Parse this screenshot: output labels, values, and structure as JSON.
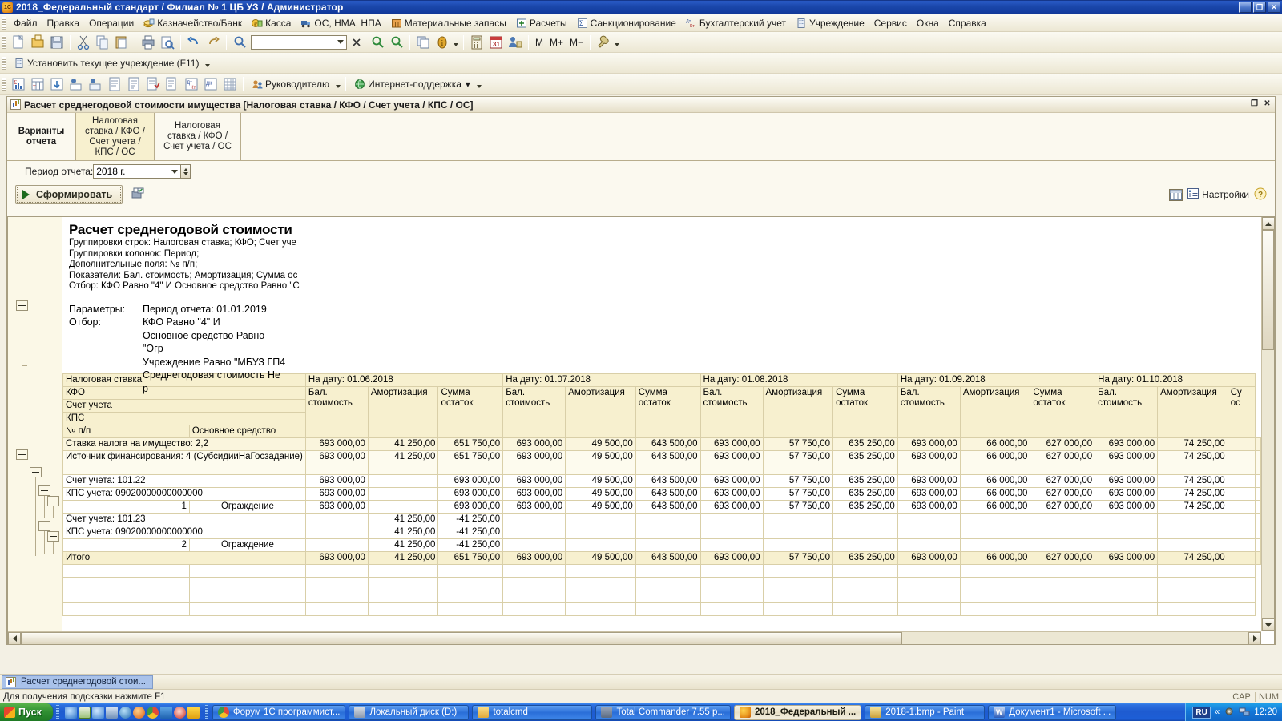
{
  "window": {
    "title": "2018_Федеральный стандарт / Филиал № 1 ЦБ УЗ / Администратор",
    "minimize": "_",
    "maximize": "❐",
    "close": "✕"
  },
  "menu": [
    {
      "label": "Файл",
      "icon": ""
    },
    {
      "label": "Правка",
      "icon": ""
    },
    {
      "label": "Операции",
      "icon": ""
    },
    {
      "label": "Казначейство/Банк",
      "icon": "money-icon"
    },
    {
      "label": "Касса",
      "icon": "cash-icon"
    },
    {
      "label": "ОС, НМА, НПА",
      "icon": "truck-icon"
    },
    {
      "label": "Материальные запасы",
      "icon": "warehouse-icon"
    },
    {
      "label": "Расчеты",
      "icon": "calc-icon"
    },
    {
      "label": "Санкционирование",
      "icon": "sigma-icon"
    },
    {
      "label": "Бухгалтерский учет",
      "icon": "dt-kt-icon"
    },
    {
      "label": "Учреждение",
      "icon": "building-icon"
    },
    {
      "label": "Сервис",
      "icon": ""
    },
    {
      "label": "Окна",
      "icon": ""
    },
    {
      "label": "Справка",
      "icon": ""
    }
  ],
  "toolbar_main": {
    "buttons": [
      "new-document-icon",
      "open-folder-icon",
      "save-icon",
      "cut-icon",
      "copy-icon",
      "paste-icon",
      "print-icon",
      "print-preview-icon",
      "undo-icon",
      "redo-icon",
      "find-icon"
    ],
    "search_value": "",
    "clear_label": "✕",
    "buttons2": [
      "refresh-find-icon",
      "find-next-icon",
      "copy-window-icon",
      "info-icon"
    ],
    "buttons3": [
      "calculator-icon",
      "calendar-icon",
      "user-settings-icon"
    ],
    "m_label": "M",
    "mplus_label": "M+",
    "mminus_label": "M−",
    "tools_icon": "wrench-icon"
  },
  "toolbar_institution": {
    "label": "Установить текущее учреждение (F11)",
    "icon": "building-icon"
  },
  "toolbar_reports": {
    "buttons": [
      "report-sigma-icon",
      "report-turnover-icon",
      "report-card-icon",
      "report-analysis-icon",
      "report-analysis2-icon",
      "report-journal-icon",
      "report-journal2-icon",
      "report-subconto-icon",
      "report-subconto2-icon",
      "report-dtkt-icon",
      "report-dtkt2-icon",
      "report-chess-icon"
    ],
    "manager_label": "Руководителю",
    "manager_icon": "manager-icon",
    "support_label": "Интернет-поддержка",
    "support_icon": "globe-icon"
  },
  "document": {
    "title": "Расчет среднегодовой стоимости имущества [Налоговая ставка / КФО / Счет учета / КПС / ОС]",
    "icon": "report-window-icon",
    "minimize": "_",
    "restore": "❐",
    "close": "✕",
    "tabs": [
      {
        "label": "Варианты отчета",
        "selected": true
      },
      {
        "label": "Налоговая ставка / КФО / Счет учета / КПС / ОС",
        "selected": false
      },
      {
        "label": "Налоговая ставка / КФО / Счет учета / ОС",
        "selected": false
      }
    ],
    "period_label": "Период отчета:",
    "period_value": "2018 г.",
    "generate_label": "Сформировать",
    "print_settings_icon": "print-settings-icon",
    "grid_icon": "grid-view-icon",
    "settings_label": "Настройки",
    "settings_icon": "settings-list-icon",
    "help_icon": "help-icon"
  },
  "report_header": {
    "title": "Расчет среднегодовой стоимости",
    "lines": [
      "Группировки строк: Налоговая ставка; КФО; Счет уче",
      "Группировки колонок: Период;",
      "Дополнительные поля: № п/п;",
      "Показатели: Бал. стоимость; Амортизация; Сумма ос",
      "Отбор: КФО Равно \"4\" И Основное средство Равно \"С"
    ],
    "params_key": "Параметры:",
    "params_value": "Период отчета: 01.01.2019",
    "filter_key": "Отбор:",
    "filter_values": [
      "КФО Равно \"4\" И",
      "Основное средство Равно \"Огр",
      "Учреждение Равно \"МБУЗ ГП4",
      "Среднегодовая стоимость Не р"
    ]
  },
  "chart_data": {
    "type": "table",
    "title": "Расчет среднегодовой стоимости",
    "row_header_labels": [
      "Налоговая ставка",
      "КФО",
      "Счет учета",
      "КПС",
      "№ п/п"
    ],
    "row_header_sub": "Основное средство",
    "column_groups": [
      "На дату: 01.06.2018",
      "На дату: 01.07.2018",
      "На дату: 01.08.2018",
      "На дату: 01.09.2018",
      "На дату: 01.10.2018"
    ],
    "measure_headers": [
      "Бал. стоимость",
      "Амортизация",
      "Сумма остаток"
    ],
    "measure_headers_split": [
      {
        "l1": "Бал.",
        "l2": "стоимость"
      },
      {
        "l1": "Амортизация",
        "l2": ""
      },
      {
        "l1": "Сумма",
        "l2": "остаток"
      }
    ],
    "last_group_truncated": {
      "l1": "Су",
      "l2": "ос"
    },
    "rows": [
      {
        "label": "Ставка налога на имущество: 2,2",
        "num": "",
        "level": 0,
        "style": "grp0",
        "values": [
          "693 000,00",
          "41 250,00",
          "651 750,00",
          "693 000,00",
          "49 500,00",
          "643 500,00",
          "693 000,00",
          "57 750,00",
          "635 250,00",
          "693 000,00",
          "66 000,00",
          "627 000,00",
          "693 000,00",
          "74 250,00"
        ]
      },
      {
        "label": "Источник финансирования: 4 (СубсидииНаГосзадание)",
        "num": "",
        "level": 1,
        "style": "grp1",
        "values": [
          "693 000,00",
          "41 250,00",
          "651 750,00",
          "693 000,00",
          "49 500,00",
          "643 500,00",
          "693 000,00",
          "57 750,00",
          "635 250,00",
          "693 000,00",
          "66 000,00",
          "627 000,00",
          "693 000,00",
          "74 250,00"
        ]
      },
      {
        "label": "Счет учета: 101.22",
        "num": "",
        "level": 2,
        "style": "white",
        "values": [
          "693 000,00",
          "",
          "693 000,00",
          "693 000,00",
          "49 500,00",
          "643 500,00",
          "693 000,00",
          "57 750,00",
          "635 250,00",
          "693 000,00",
          "66 000,00",
          "627 000,00",
          "693 000,00",
          "74 250,00"
        ]
      },
      {
        "label": "КПС учета: 09020000000000000",
        "num": "",
        "level": 3,
        "style": "white",
        "values": [
          "693 000,00",
          "",
          "693 000,00",
          "693 000,00",
          "49 500,00",
          "643 500,00",
          "693 000,00",
          "57 750,00",
          "635 250,00",
          "693 000,00",
          "66 000,00",
          "627 000,00",
          "693 000,00",
          "74 250,00"
        ]
      },
      {
        "label": "Ограждение",
        "num": "1",
        "level": 4,
        "style": "white",
        "values": [
          "693 000,00",
          "",
          "693 000,00",
          "693 000,00",
          "49 500,00",
          "643 500,00",
          "693 000,00",
          "57 750,00",
          "635 250,00",
          "693 000,00",
          "66 000,00",
          "627 000,00",
          "693 000,00",
          "74 250,00"
        ]
      },
      {
        "label": "Счет учета: 101.23",
        "num": "",
        "level": 2,
        "style": "white",
        "values": [
          "",
          "41 250,00",
          "-41 250,00",
          "",
          "",
          "",
          "",
          "",
          "",
          "",
          "",
          "",
          "",
          ""
        ]
      },
      {
        "label": "КПС учета: 09020000000000000",
        "num": "",
        "level": 3,
        "style": "white",
        "values": [
          "",
          "41 250,00",
          "-41 250,00",
          "",
          "",
          "",
          "",
          "",
          "",
          "",
          "",
          "",
          "",
          ""
        ]
      },
      {
        "label": "Ограждение",
        "num": "2",
        "level": 4,
        "style": "white",
        "values": [
          "",
          "41 250,00",
          "-41 250,00",
          "",
          "",
          "",
          "",
          "",
          "",
          "",
          "",
          "",
          "",
          ""
        ]
      },
      {
        "label": "Итого",
        "num": "",
        "level": 0,
        "style": "total",
        "values": [
          "693 000,00",
          "41 250,00",
          "651 750,00",
          "693 000,00",
          "49 500,00",
          "643 500,00",
          "693 000,00",
          "57 750,00",
          "635 250,00",
          "693 000,00",
          "66 000,00",
          "627 000,00",
          "693 000,00",
          "74 250,00"
        ]
      }
    ]
  },
  "window_list": [
    {
      "label": "Расчет среднегодовой стои...",
      "icon": "report-window-icon",
      "active": true
    }
  ],
  "statusbar": {
    "hint": "Для получения подсказки нажмите F1",
    "caps": "CAP",
    "num": "NUM"
  },
  "taskbar": {
    "start_label": "Пуск",
    "quicklaunch": [
      "ie-icon",
      "excel-icon",
      "ie2-icon",
      "phone-icon",
      "media-icon",
      "firefox-icon",
      "chrome-icon",
      "opera-icon",
      "browser-icon",
      "o-icon"
    ],
    "tasks": [
      {
        "label": "Форум 1С программист...",
        "icon": "chrome-icon",
        "active": false
      },
      {
        "label": "Локальный диск (D:)",
        "icon": "drive-icon",
        "active": false
      },
      {
        "label": "totalcmd",
        "icon": "folder-icon",
        "active": false
      },
      {
        "label": "Total Commander 7.55 p...",
        "icon": "floppy-icon",
        "active": false
      },
      {
        "label": "2018_Федеральный ...",
        "icon": "1c-icon",
        "active": true
      },
      {
        "label": "2018-1.bmp - Paint",
        "icon": "paint-icon",
        "active": false
      },
      {
        "label": "Документ1 - Microsoft ...",
        "icon": "word-icon",
        "active": false
      }
    ],
    "lang": "RU",
    "chevron": "«",
    "tray_icons": [
      "gear-icon",
      "network-icon"
    ],
    "clock": "12:20"
  },
  "colors": {
    "title_bar": "#0a246a",
    "header_cell": "#f7f0cf",
    "group_row": "#faf5dd",
    "cell_border": "#d9cfa8",
    "window_bg": "#fbf9ef"
  }
}
